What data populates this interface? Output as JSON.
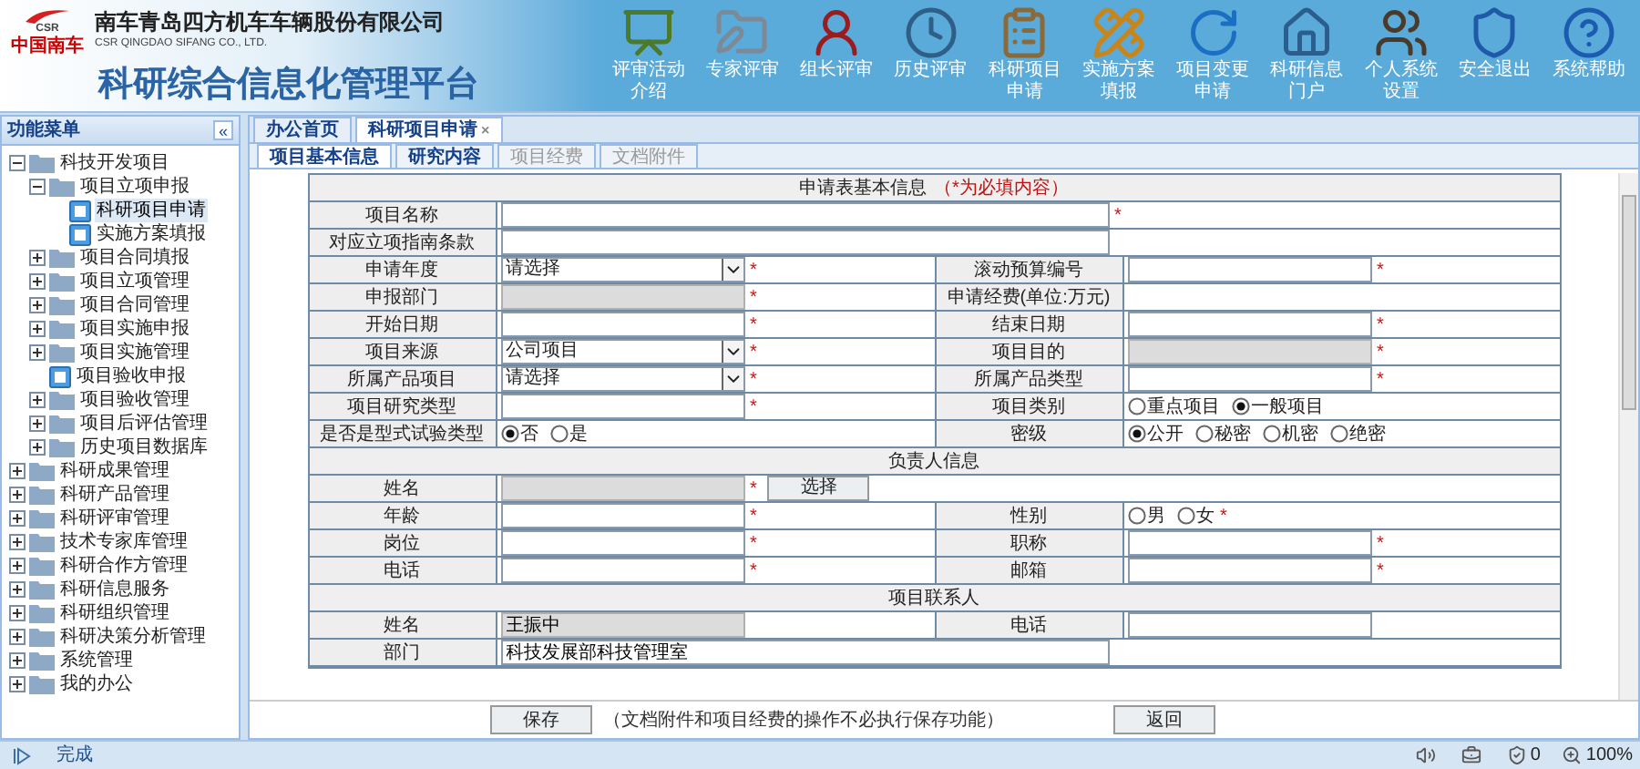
{
  "header": {
    "logo_mark": "CSR",
    "logo_text": "中国南车",
    "company_name": "南车青岛四方机车车辆股份有限公司",
    "company_name_en": "CSR QINGDAO SIFANG CO., LTD.",
    "platform_title": "科研综合信息化管理平台",
    "toolbar": [
      {
        "label": "评审活动介绍",
        "kind": "board"
      },
      {
        "label": "专家评审",
        "kind": "folder"
      },
      {
        "label": "组长评审",
        "kind": "person"
      },
      {
        "label": "历史评审",
        "kind": "clock"
      },
      {
        "label": "科研项目申请",
        "kind": "clipboard"
      },
      {
        "label": "实施方案填报",
        "kind": "pencil"
      },
      {
        "label": "项目变更申请",
        "kind": "refresh"
      },
      {
        "label": "科研信息门户",
        "kind": "home"
      },
      {
        "label": "个人系统设置",
        "kind": "users"
      },
      {
        "label": "安全退出",
        "kind": "shield"
      },
      {
        "label": "系统帮助",
        "kind": "help"
      }
    ]
  },
  "sidebar": {
    "title": "功能菜单",
    "collapse": "«",
    "items": [
      {
        "label": "科技开发项目",
        "kind": "folder",
        "expanded": true,
        "selected": false,
        "children": [
          {
            "label": "项目立项申报",
            "kind": "folder",
            "expanded": true,
            "selected": false,
            "children": [
              {
                "label": "科研项目申请",
                "kind": "doc",
                "selected": true
              },
              {
                "label": "实施方案填报",
                "kind": "doc",
                "selected": false
              }
            ]
          },
          {
            "label": "项目合同填报",
            "kind": "folder",
            "expanded": false,
            "selected": false
          },
          {
            "label": "项目立项管理",
            "kind": "folder",
            "expanded": false,
            "selected": false
          },
          {
            "label": "项目合同管理",
            "kind": "folder",
            "expanded": false,
            "selected": false
          },
          {
            "label": "项目实施申报",
            "kind": "folder",
            "expanded": false,
            "selected": false
          },
          {
            "label": "项目实施管理",
            "kind": "folder",
            "expanded": false,
            "selected": false
          },
          {
            "label": "项目验收申报",
            "kind": "doc",
            "selected": false
          },
          {
            "label": "项目验收管理",
            "kind": "folder",
            "expanded": false,
            "selected": false
          },
          {
            "label": "项目后评估管理",
            "kind": "folder",
            "expanded": false,
            "selected": false
          },
          {
            "label": "历史项目数据库",
            "kind": "folder",
            "expanded": false,
            "selected": false
          }
        ]
      },
      {
        "label": "科研成果管理",
        "kind": "folder",
        "expanded": false,
        "selected": false
      },
      {
        "label": "科研产品管理",
        "kind": "folder",
        "expanded": false,
        "selected": false
      },
      {
        "label": "科研评审管理",
        "kind": "folder",
        "expanded": false,
        "selected": false
      },
      {
        "label": "技术专家库管理",
        "kind": "folder",
        "expanded": false,
        "selected": false
      },
      {
        "label": "科研合作方管理",
        "kind": "folder",
        "expanded": false,
        "selected": false
      },
      {
        "label": "科研信息服务",
        "kind": "folder",
        "expanded": false,
        "selected": false
      },
      {
        "label": "科研组织管理",
        "kind": "folder",
        "expanded": false,
        "selected": false
      },
      {
        "label": "科研决策分析管理",
        "kind": "folder",
        "expanded": false,
        "selected": false
      },
      {
        "label": "系统管理",
        "kind": "folder",
        "expanded": false,
        "selected": false
      },
      {
        "label": "我的办公",
        "kind": "folder",
        "expanded": false,
        "selected": false
      }
    ]
  },
  "tabs": [
    {
      "label": "办公首页",
      "selected": false,
      "closable": false
    },
    {
      "label": "科研项目申请",
      "selected": true,
      "closable": true
    }
  ],
  "close_glyph": "×",
  "sub_tabs": [
    {
      "label": "项目基本信息",
      "selected": true,
      "disabled": false
    },
    {
      "label": "研究内容",
      "selected": false,
      "disabled": false
    },
    {
      "label": "项目经费",
      "selected": false,
      "disabled": true
    },
    {
      "label": "文档附件",
      "selected": false,
      "disabled": true
    }
  ],
  "form": [
    {
      "kind": "section",
      "title": "申请表基本信息",
      "note": "（*为必填内容）"
    },
    {
      "kind": "row",
      "fields": [
        {
          "label": "项目名称",
          "kind": "text",
          "wide": true,
          "required": true
        }
      ]
    },
    {
      "kind": "row",
      "fields": [
        {
          "label": "对应立项指南条款",
          "kind": "text",
          "wide": true
        }
      ]
    },
    {
      "kind": "row",
      "fields": [
        {
          "label": "申请年度",
          "kind": "select",
          "value": "请选择",
          "required": true
        },
        {
          "label": "滚动预算编号",
          "kind": "text",
          "required": true
        }
      ]
    },
    {
      "kind": "row",
      "fields": [
        {
          "label": "申报部门",
          "kind": "readonly",
          "required": true
        },
        {
          "label": "申请经费(单位:万元)",
          "kind": "none"
        }
      ]
    },
    {
      "kind": "row",
      "fields": [
        {
          "label": "开始日期",
          "kind": "text",
          "required": true
        },
        {
          "label": "结束日期",
          "kind": "text",
          "required": true
        }
      ]
    },
    {
      "kind": "row",
      "fields": [
        {
          "label": "项目来源",
          "kind": "select",
          "value": "公司项目",
          "required": true
        },
        {
          "label": "项目目的",
          "kind": "readonly",
          "required": true
        }
      ]
    },
    {
      "kind": "row",
      "fields": [
        {
          "label": "所属产品项目",
          "kind": "select",
          "value": "请选择",
          "required": true
        },
        {
          "label": "所属产品类型",
          "kind": "text",
          "required": true
        }
      ]
    },
    {
      "kind": "row",
      "fields": [
        {
          "label": "项目研究类型",
          "kind": "text",
          "required": true
        },
        {
          "label": "项目类别",
          "kind": "radio",
          "options": [
            {
              "label": "重点项目",
              "selected": false
            },
            {
              "label": "一般项目",
              "selected": true
            }
          ]
        }
      ]
    },
    {
      "kind": "row",
      "fields": [
        {
          "label": "是否是型式试验类型",
          "kind": "radio",
          "options": [
            {
              "label": "否",
              "selected": true
            },
            {
              "label": "是",
              "selected": false
            }
          ]
        },
        {
          "label": "密级",
          "kind": "radio",
          "options": [
            {
              "label": "公开",
              "selected": true
            },
            {
              "label": "秘密",
              "selected": false
            },
            {
              "label": "机密",
              "selected": false
            },
            {
              "label": "绝密",
              "selected": false
            }
          ]
        }
      ]
    },
    {
      "kind": "section",
      "title": "负责人信息"
    },
    {
      "kind": "row",
      "fields": [
        {
          "label": "姓名",
          "kind": "readonly",
          "required": true,
          "button": "选择"
        }
      ]
    },
    {
      "kind": "row",
      "fields": [
        {
          "label": "年龄",
          "kind": "text",
          "required": true
        },
        {
          "label": "性别",
          "kind": "radio",
          "required": true,
          "options": [
            {
              "label": "男",
              "selected": false
            },
            {
              "label": "女",
              "selected": false
            }
          ]
        }
      ]
    },
    {
      "kind": "row",
      "fields": [
        {
          "label": "岗位",
          "kind": "text",
          "required": true
        },
        {
          "label": "职称",
          "kind": "text",
          "required": true
        }
      ]
    },
    {
      "kind": "row",
      "fields": [
        {
          "label": "电话",
          "kind": "text",
          "required": true
        },
        {
          "label": "邮箱",
          "kind": "text",
          "required": true
        }
      ]
    },
    {
      "kind": "section",
      "title": "项目联系人"
    },
    {
      "kind": "row",
      "fields": [
        {
          "label": "姓名",
          "kind": "readonly",
          "value": "王振中"
        },
        {
          "label": "电话",
          "kind": "text"
        }
      ]
    },
    {
      "kind": "row",
      "fields": [
        {
          "label": "部门",
          "kind": "text",
          "wide": true,
          "value": "科技发展部科技管理室"
        }
      ]
    }
  ],
  "required_mark": "*",
  "footer": {
    "save": "保存",
    "note": "（文档附件和项目经费的操作不必执行保存功能）",
    "back": "返回"
  },
  "status_bar": {
    "status": "完成",
    "count": "0",
    "zoom": "100%"
  }
}
